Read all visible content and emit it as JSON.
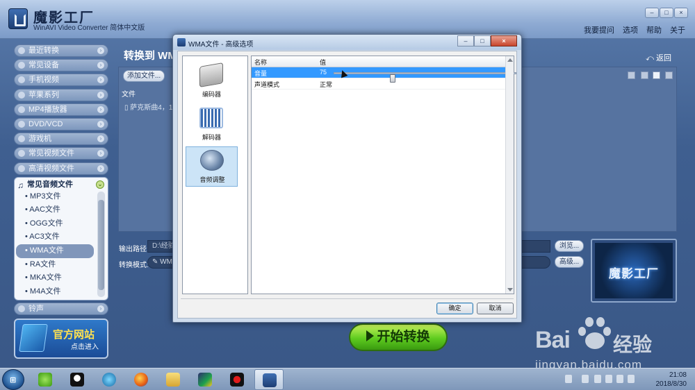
{
  "app": {
    "title": "魔影工厂",
    "subtitle": "WinAVI Video Converter 简体中文版",
    "menu": [
      "我要提问",
      "选项",
      "帮助",
      "关于"
    ],
    "window_buttons": [
      "–",
      "□",
      "×"
    ]
  },
  "sidebar": {
    "categories": [
      {
        "label": "最近转换",
        "icon": "clock-icon"
      },
      {
        "label": "常见设备",
        "icon": "device-icon"
      },
      {
        "label": "手机视频",
        "icon": "phone-icon"
      },
      {
        "label": "苹果系列",
        "icon": "apple-icon"
      },
      {
        "label": "MP4播放器",
        "icon": "mp4-icon"
      },
      {
        "label": "DVD/VCD",
        "icon": "disc-icon"
      },
      {
        "label": "游戏机",
        "icon": "gamepad-icon"
      },
      {
        "label": "常见视频文件",
        "icon": "video-file-icon"
      },
      {
        "label": "高清视频文件",
        "icon": "hd-video-icon"
      }
    ],
    "open_category": {
      "label": "常见音频文件",
      "icon": "music-note-icon",
      "items": [
        "• MP3文件",
        "• AAC文件",
        "• OGG文件",
        "• AC3文件",
        "• WMA文件",
        "• RA文件",
        "• MKA文件",
        "• M4A文件"
      ],
      "selected_index": 4
    },
    "last_category": {
      "label": "铃声",
      "icon": "bell-icon"
    },
    "banner": {
      "title": "官方网站",
      "subtitle": "点击进入"
    }
  },
  "main": {
    "title": "转换到 WMA",
    "return_label": "返回",
    "add_file_label": "添加文件...",
    "file_column": "文件",
    "file_item": "萨克斯曲4，1",
    "output_label": "输出路径:",
    "output_value": "D:\\经验",
    "mode_label": "转换模式:",
    "mode_value": "WMA",
    "browse_label": "浏览...",
    "advanced_label": "高级...",
    "preview_logo": "魔影工厂",
    "start_label": "开始转换"
  },
  "dialog": {
    "title": "WMA文件 - 高级选项",
    "left_items": [
      {
        "label": "编码器",
        "icon": "encoder-icon"
      },
      {
        "label": "解码器",
        "icon": "decoder-icon"
      },
      {
        "label": "音频调整",
        "icon": "speaker-icon"
      }
    ],
    "selected_left_index": 2,
    "grid": {
      "col_name": "名称",
      "col_value": "值",
      "rows": [
        {
          "name": "音量",
          "value": "75",
          "slider_level": 75
        },
        {
          "name": "声道模式",
          "value": "正常"
        }
      ]
    },
    "ok_label": "确定",
    "cancel_label": "取消",
    "buttons": [
      "–",
      "□",
      "×"
    ]
  },
  "watermark": {
    "brand": "Bai",
    "brand_suffix": "经验",
    "url": "jingyan.baidu.com"
  },
  "taskbar": {
    "start": "start-orb",
    "apps": [
      "360-icon",
      "qq-icon",
      "media-icon",
      "firefox-icon",
      "folder-icon",
      "video-editor-icon",
      "recorder-icon",
      "winavi-icon"
    ],
    "time": "21:08",
    "date": "2018/8/30"
  },
  "colors": {
    "accent": "#3399ff",
    "start_button": "#5ecb1f",
    "app_bg": "#3f5f90"
  }
}
